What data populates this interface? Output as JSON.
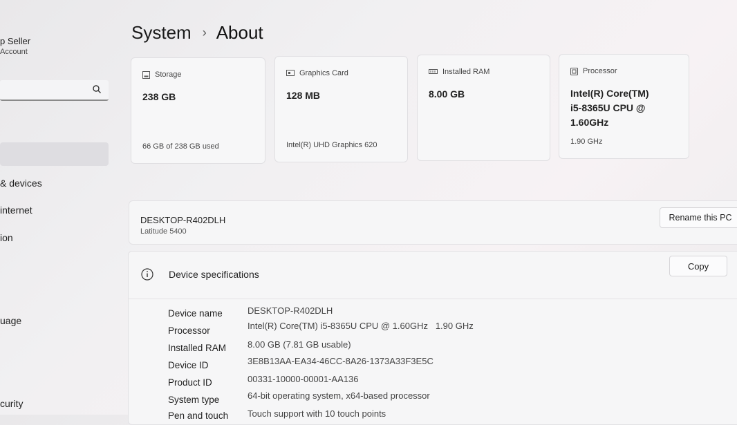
{
  "user": {
    "name": "p Seller",
    "account": "Account"
  },
  "search": {
    "placeholder": ""
  },
  "nav": [
    "& devices",
    "internet",
    "ion",
    "uage",
    "curity"
  ],
  "breadcrumb": {
    "parent": "System",
    "separator": "›",
    "current": "About"
  },
  "cards": [
    {
      "header": "Storage",
      "icon": "storage-icon",
      "value": "238 GB",
      "sub": "66 GB of 238 GB used"
    },
    {
      "header": "Graphics Card",
      "icon": "graphics-card-icon",
      "value": "128 MB",
      "sub": "Intel(R) UHD Graphics 620"
    },
    {
      "header": "Installed RAM",
      "icon": "ram-icon",
      "value": "8.00 GB",
      "sub": ""
    },
    {
      "header": "Processor",
      "icon": "processor-icon",
      "value_lines": [
        "Intel(R) Core(TM)",
        "i5-8365U CPU @",
        "1.60GHz"
      ],
      "sub": "1.90 GHz"
    }
  ],
  "pc": {
    "name": "DESKTOP-R402DLH",
    "model": "Latitude 5400",
    "rename_label": "Rename this PC"
  },
  "specs": {
    "title": "Device specifications",
    "copy_label": "Copy",
    "rows": [
      {
        "label": "Device name",
        "value": "DESKTOP-R402DLH"
      },
      {
        "label": "Processor",
        "value": "Intel(R) Core(TM) i5-8365U CPU @ 1.60GHz   1.90 GHz"
      },
      {
        "label": "Installed RAM",
        "value": "8.00 GB (7.81 GB usable)"
      },
      {
        "label": "Device ID",
        "value": "3E8B13AA-EA34-46CC-8A26-1373A33F3E5C"
      },
      {
        "label": "Product ID",
        "value": "00331-10000-00001-AA136"
      },
      {
        "label": "System type",
        "value": "64-bit operating system, x64-based processor"
      },
      {
        "label": "Pen and touch",
        "value": "Touch support with 10 touch points"
      }
    ]
  }
}
